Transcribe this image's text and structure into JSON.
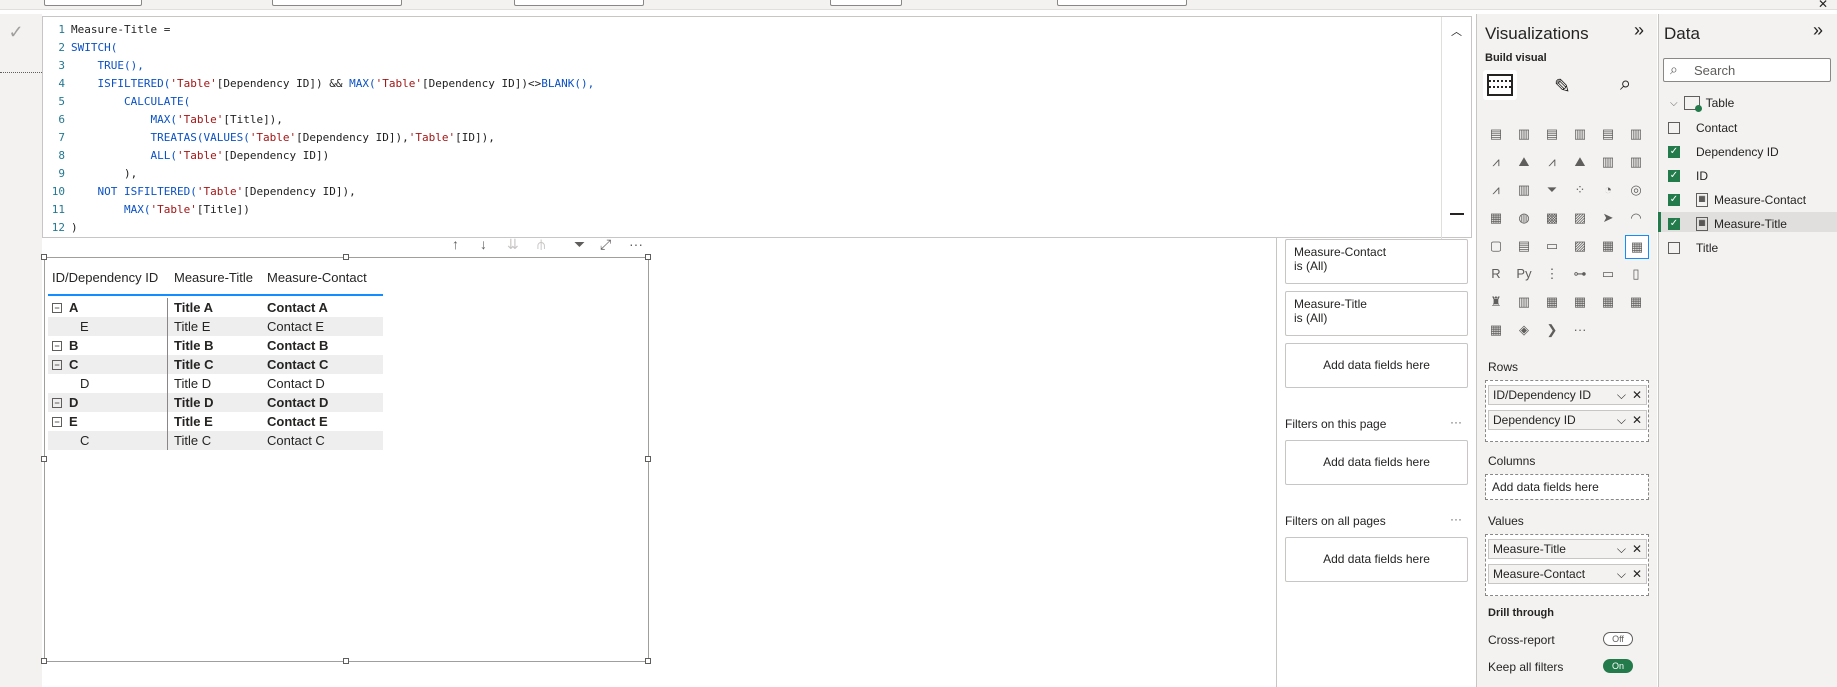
{
  "editor": {
    "lines": [
      {
        "n": "1",
        "segs": [
          {
            "t": "Measure-Title = ",
            "k": "txt"
          }
        ]
      },
      {
        "n": "2",
        "segs": [
          {
            "t": "SWITCH(",
            "k": "fn"
          }
        ]
      },
      {
        "n": "3",
        "segs": [
          {
            "t": "    TRUE(),",
            "k": "fn"
          }
        ]
      },
      {
        "n": "4",
        "segs": [
          {
            "t": "    ISFILTERED(",
            "k": "fn"
          },
          {
            "t": "'Table'",
            "k": "str"
          },
          {
            "t": "[Dependency ID]) && ",
            "k": "txt"
          },
          {
            "t": "MAX(",
            "k": "fn"
          },
          {
            "t": "'Table'",
            "k": "str"
          },
          {
            "t": "[Dependency ID])<>",
            "k": "txt"
          },
          {
            "t": "BLANK(),",
            "k": "fn"
          }
        ]
      },
      {
        "n": "5",
        "segs": [
          {
            "t": "        CALCULATE(",
            "k": "fn"
          }
        ]
      },
      {
        "n": "6",
        "segs": [
          {
            "t": "            MAX(",
            "k": "fn"
          },
          {
            "t": "'Table'",
            "k": "str"
          },
          {
            "t": "[Title]),",
            "k": "txt"
          }
        ]
      },
      {
        "n": "7",
        "segs": [
          {
            "t": "            TREATAS(",
            "k": "fn"
          },
          {
            "t": "VALUES(",
            "k": "fn"
          },
          {
            "t": "'Table'",
            "k": "str"
          },
          {
            "t": "[Dependency ID]),",
            "k": "txt"
          },
          {
            "t": "'Table'",
            "k": "str"
          },
          {
            "t": "[ID]),",
            "k": "txt"
          }
        ]
      },
      {
        "n": "8",
        "segs": [
          {
            "t": "            ALL(",
            "k": "fn"
          },
          {
            "t": "'Table'",
            "k": "str"
          },
          {
            "t": "[Dependency ID])",
            "k": "txt"
          }
        ]
      },
      {
        "n": "9",
        "segs": [
          {
            "t": "        ),",
            "k": "txt"
          }
        ]
      },
      {
        "n": "10",
        "segs": [
          {
            "t": "    NOT ",
            "k": "fn"
          },
          {
            "t": "ISFILTERED(",
            "k": "fn"
          },
          {
            "t": "'Table'",
            "k": "str"
          },
          {
            "t": "[Dependency ID]),",
            "k": "txt"
          }
        ]
      },
      {
        "n": "11",
        "segs": [
          {
            "t": "        MAX(",
            "k": "fn"
          },
          {
            "t": "'Table'",
            "k": "str"
          },
          {
            "t": "[Title])",
            "k": "txt"
          }
        ]
      },
      {
        "n": "12",
        "segs": [
          {
            "t": ")",
            "k": "txt"
          }
        ]
      }
    ]
  },
  "matrix": {
    "headers": [
      "ID/Dependency ID",
      "Measure-Title",
      "Measure-Contact"
    ],
    "rows": [
      {
        "id": "A",
        "title": "Title A",
        "contact": "Contact A",
        "bold": true,
        "expand": true,
        "alt": false
      },
      {
        "id": "E",
        "title": "Title E",
        "contact": "Contact E",
        "bold": false,
        "expand": false,
        "alt": true
      },
      {
        "id": "B",
        "title": "Title B",
        "contact": "Contact B",
        "bold": true,
        "expand": true,
        "alt": false
      },
      {
        "id": "C",
        "title": "Title C",
        "contact": "Contact C",
        "bold": true,
        "expand": true,
        "alt": true
      },
      {
        "id": "D",
        "title": "Title D",
        "contact": "Contact D",
        "bold": false,
        "expand": false,
        "alt": false
      },
      {
        "id": "D",
        "title": "Title D",
        "contact": "Contact D",
        "bold": true,
        "expand": true,
        "alt": true
      },
      {
        "id": "E",
        "title": "Title E",
        "contact": "Contact E",
        "bold": true,
        "expand": true,
        "alt": false
      },
      {
        "id": "C",
        "title": "Title C",
        "contact": "Contact C",
        "bold": false,
        "expand": false,
        "alt": true
      }
    ],
    "expander_glyph": "⊟"
  },
  "filters": {
    "visual_filters": [
      {
        "name": "Measure-Contact",
        "state": "is (All)"
      },
      {
        "name": "Measure-Title",
        "state": "is (All)"
      }
    ],
    "add_fields": "Add data fields here",
    "page_label": "Filters on this page",
    "all_label": "Filters on all pages",
    "more": "···"
  },
  "viz": {
    "title": "Visualizations",
    "collapse": "»",
    "build_visual": "Build visual",
    "more_visuals": "···",
    "rows_label": "Rows",
    "rows": [
      "ID/Dependency ID",
      "Dependency ID"
    ],
    "columns_label": "Columns",
    "columns_placeholder": "Add data fields here",
    "values_label": "Values",
    "values": [
      "Measure-Title",
      "Measure-Contact"
    ],
    "drill_label": "Drill through",
    "cross_report": "Cross-report",
    "cross_state": "Off",
    "keep_filters": "Keep all filters",
    "keep_state": "On",
    "accent": "#237b4b"
  },
  "data": {
    "title": "Data",
    "collapse": "»",
    "search_placeholder": "Search",
    "table_name": "Table",
    "fields": [
      {
        "label": "Contact",
        "checked": false,
        "measure": false
      },
      {
        "label": "Dependency ID",
        "checked": true,
        "measure": false
      },
      {
        "label": "ID",
        "checked": true,
        "measure": false
      },
      {
        "label": "Measure-Contact",
        "checked": true,
        "measure": true
      },
      {
        "label": "Measure-Title",
        "checked": true,
        "measure": true
      },
      {
        "label": "Title",
        "checked": false,
        "measure": false
      }
    ]
  },
  "window": {
    "close": "✕"
  }
}
